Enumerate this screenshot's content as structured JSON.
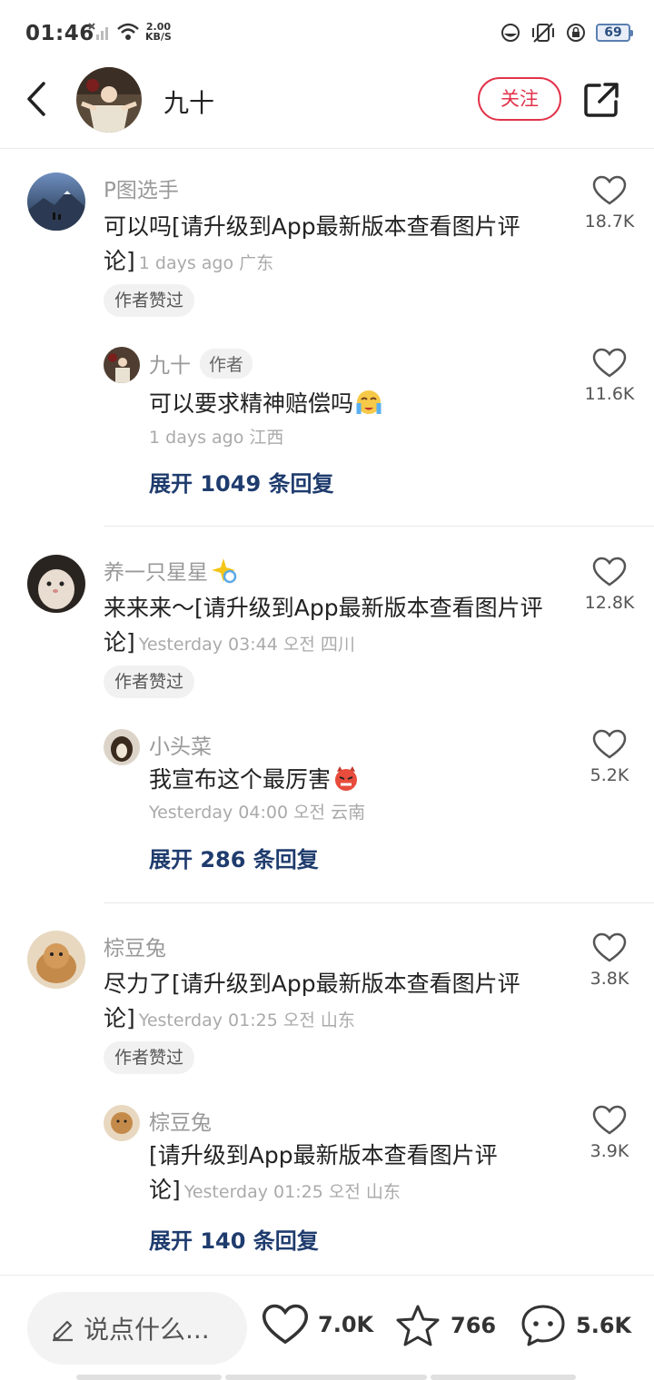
{
  "status": {
    "time": "01:46",
    "net_speed_value": "2.00",
    "net_speed_unit": "KB/S",
    "battery": "69"
  },
  "header": {
    "name": "九十",
    "follow_label": "关注"
  },
  "threads": [
    {
      "user": "P图选手",
      "text": "可以吗[请升级到App最新版本查看图片评论]",
      "meta": "1 days ago 广东",
      "likes": "18.7K",
      "liked_tag": "作者赞过",
      "reply": {
        "user": "九十",
        "author_tag": "作者",
        "text": "可以要求精神赔偿吗",
        "meta": "1 days ago 江西",
        "likes": "11.6K"
      },
      "expand": "展开 1049 条回复"
    },
    {
      "user": "养一只星星",
      "text": "来来来～[请升级到App最新版本查看图片评论]",
      "meta": "Yesterday 03:44 오전 四川",
      "likes": "12.8K",
      "liked_tag": "作者赞过",
      "reply": {
        "user": "小头菜",
        "text": "我宣布这个最厉害",
        "meta": "Yesterday 04:00 오전 云南",
        "likes": "5.2K"
      },
      "expand": "展开 286 条回复"
    },
    {
      "user": "棕豆兔",
      "text": "尽力了[请升级到App最新版本查看图片评论]",
      "meta": "Yesterday 01:25 오전 山东",
      "likes": "3.8K",
      "liked_tag": "作者赞过",
      "reply": {
        "user": "棕豆兔",
        "text": "[请升级到App最新版本查看图片评论]",
        "meta": "Yesterday 01:25 오전 山东",
        "likes": "3.9K"
      },
      "expand": "展开 140 条回复"
    }
  ],
  "bottom": {
    "input_placeholder": "说点什么...",
    "likes": "7.0K",
    "favorites": "766",
    "comments": "5.6K"
  }
}
